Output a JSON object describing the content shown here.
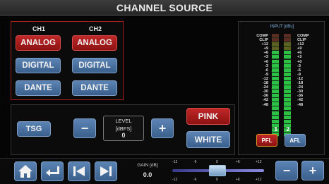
{
  "title": "CHANNEL SOURCE",
  "source": {
    "ch1_label": "CH1",
    "ch2_label": "CH2",
    "ch1": {
      "analog": "ANALOG",
      "digital": "DIGITAL",
      "dante": "DANTE",
      "selected": "ANALOG"
    },
    "ch2": {
      "analog": "ANALOG",
      "digital": "DIGITAL",
      "dante": "DANTE",
      "selected": "ANALOG"
    }
  },
  "generator": {
    "tsg_label": "TSG",
    "minus_label": "−",
    "plus_label": "+",
    "level_title": "LEVEL",
    "level_unit": "[dBFS]",
    "level_value": "0",
    "pink_label": "PINK",
    "white_label": "WHITE",
    "selected_noise": "PINK"
  },
  "meter": {
    "title": "INPUT [dBu]",
    "scale_left": [
      "COMP",
      "CLIP",
      "+12",
      "+9",
      "+6",
      "+3",
      "+0",
      "-3",
      "-6",
      "-9",
      "-12",
      "-18",
      "-24",
      "-30",
      "-36",
      "-42",
      "-48"
    ],
    "scale_right": [
      "COMP",
      "CLIP",
      "+12",
      "+9",
      "+6",
      "+3",
      "+0",
      "-3",
      "-6",
      "-9",
      "-12",
      "-18",
      "-24",
      "-30",
      "-36",
      "-42",
      "-48"
    ],
    "ch1_label": "1",
    "ch2_label": "2",
    "pfl_label": "PFL",
    "afl_label": "AFL",
    "colors": {
      "green": "#2fd24a",
      "yellow": "#d8c82a",
      "red": "#d83030"
    }
  },
  "bottom": {
    "home_icon": "home-icon",
    "back_icon": "return-icon",
    "prev_icon": "skip-back-icon",
    "next_icon": "skip-forward-icon",
    "gain_label": "GAIN [dB]",
    "gain_value": "0.0",
    "gain_scale": [
      "-12",
      "-6",
      "0",
      "+6",
      "+12"
    ],
    "minus_label": "−",
    "plus_label": "+"
  }
}
